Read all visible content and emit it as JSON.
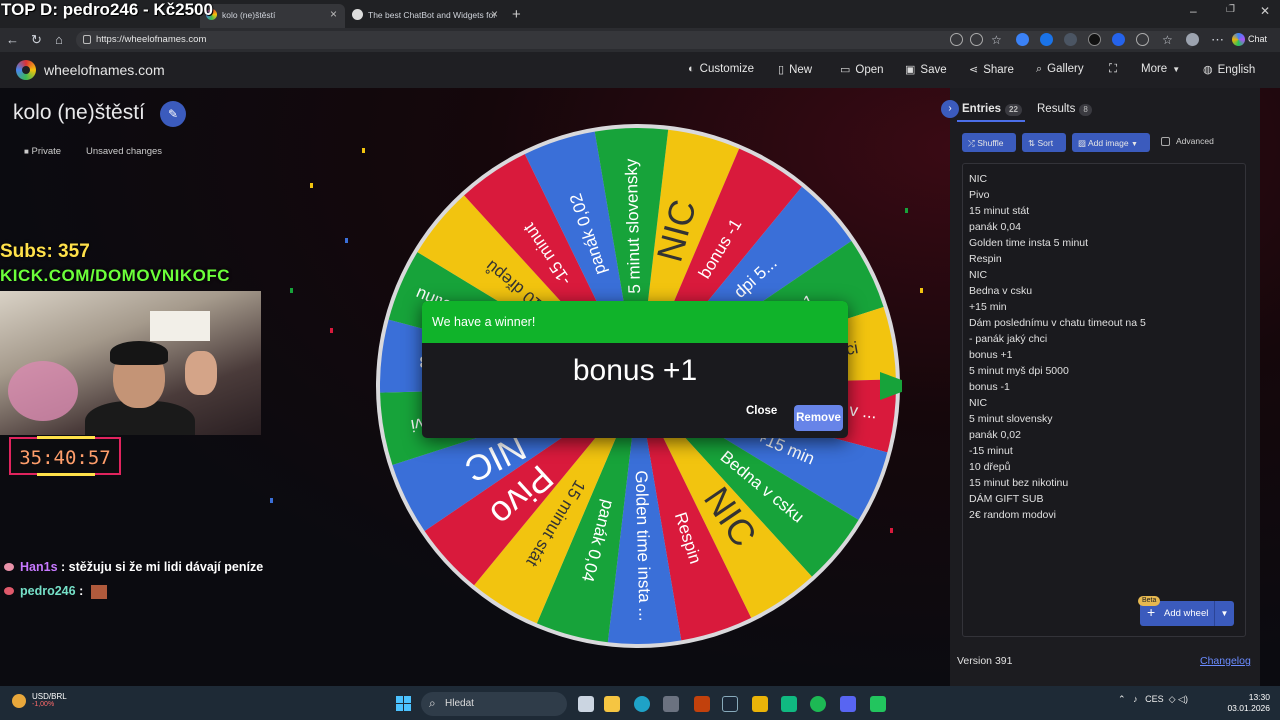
{
  "overlay": {
    "stream_title": "TOP D: pedro246 - Kč2500",
    "subs": "Subs: 357",
    "kick": "KICK.COM/DOMOVNIKOFC",
    "timer": "35:40:57",
    "chat": [
      {
        "user": "Han1s",
        "message": ": stěžuju si že mi lidi dávají peníze"
      },
      {
        "user": "pedro246",
        "message": ":"
      }
    ]
  },
  "browser": {
    "tabs": [
      {
        "label": "kolo (ne)štěstí"
      },
      {
        "label": "The best ChatBot and Widgets for"
      }
    ],
    "url": "https://wheelofnames.com",
    "chat_button": "Chat"
  },
  "site": {
    "name": "wheelofnames.com",
    "menu": [
      "Customize",
      "New",
      "Open",
      "Save",
      "Share",
      "Gallery",
      "More",
      "English"
    ]
  },
  "wheel": {
    "title": "kolo (ne)štěstí",
    "private_label": "Private",
    "unsaved_label": "Unsaved changes",
    "segments": [
      {
        "label": "NIC",
        "color": "#f2c40f"
      },
      {
        "label": "bonus -1",
        "color": "#d91a3c"
      },
      {
        "label": "dpi 5...",
        "color": "#3a6fd8"
      },
      {
        "label": "bonus +1",
        "color": "#17a33a"
      },
      {
        "label": "- panák jaký chci",
        "color": "#f2c40f"
      },
      {
        "label": "Dám poslednímu v ...",
        "color": "#d91a3c"
      },
      {
        "label": "+15 min",
        "color": "#3a6fd8"
      },
      {
        "label": "Bedna v csku",
        "color": "#17a33a"
      },
      {
        "label": "NIC",
        "color": "#f2c40f"
      },
      {
        "label": "Respin",
        "color": "#d91a3c"
      },
      {
        "label": "Golden time insta ...",
        "color": "#3a6fd8"
      },
      {
        "label": "panák 0,04",
        "color": "#17a33a"
      },
      {
        "label": "15 minut stát",
        "color": "#f2c40f"
      },
      {
        "label": "Pivo",
        "color": "#d91a3c"
      },
      {
        "label": "NIC",
        "color": "#3a6fd8"
      },
      {
        "label": "2€ random modovi",
        "color": "#17a33a"
      },
      {
        "label": "DÁM GIFT SUB",
        "color": "#3a6fd8"
      },
      {
        "label": "15 minut bez nikotinu",
        "color": "#17a33a"
      },
      {
        "label": "10 dřepů",
        "color": "#f2c40f"
      },
      {
        "label": "-15 minut",
        "color": "#d91a3c"
      },
      {
        "label": "panák 0,02",
        "color": "#3a6fd8"
      },
      {
        "label": "5 minut slovensky",
        "color": "#17a33a"
      }
    ]
  },
  "modal": {
    "header": "We have a winner!",
    "winner": "bonus +1",
    "close_label": "Close",
    "remove_label": "Remove"
  },
  "panel": {
    "entries_tab": "Entries",
    "entries_count": "22",
    "results_tab": "Results",
    "results_count": "8",
    "shuffle": "Shuffle",
    "sort": "Sort",
    "add_image": "Add image",
    "advanced": "Advanced",
    "entries": [
      "NIC",
      "Pivo",
      "15 minut stát",
      "panák 0,04",
      "Golden time insta 5 minut",
      "Respin",
      "NIC",
      "Bedna v csku",
      "+15 min",
      "Dám poslednímu v chatu timeout na 5",
      "- panák jaký chci",
      "bonus +1",
      "5 minut myš dpi 5000",
      "bonus -1",
      "NIC",
      "5 minut slovensky",
      "panák 0,02",
      "-15 minut",
      "10 dřepů",
      "15 minut bez nikotinu",
      "DÁM GIFT SUB",
      "2€ random modovi"
    ],
    "beta": "Beta",
    "add_wheel": "Add wheel",
    "version": "Version 391",
    "changelog": "Changelog"
  },
  "taskbar": {
    "stock_name": "USD/BRL",
    "stock_change": "-1,00%",
    "search_placeholder": "Hledat",
    "language": "CES",
    "time": "13:30",
    "date": "03.01.2026"
  }
}
